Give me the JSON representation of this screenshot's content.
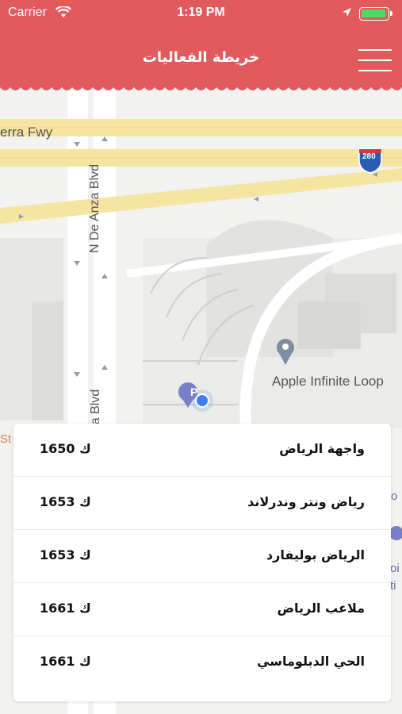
{
  "status_bar": {
    "carrier": "Carrier",
    "time": "1:19 PM",
    "battery_color": "#4cd964"
  },
  "header": {
    "title": "خريطة الفعاليات",
    "background": "#e05a5e",
    "menu_icon": "hamburger-icon"
  },
  "map": {
    "labels": {
      "freeway": "erra Fwy",
      "street_1": "N De Anza Blvd",
      "street_2": "a Blvd",
      "poi": "Apple Infinite Loop",
      "shield": "280",
      "edge_left_1": "St",
      "edge_right_1": "o",
      "edge_right_2": "oi",
      "edge_right_3": "ti"
    },
    "parking_icon_letter": "P"
  },
  "events": [
    {
      "name": "واجهة الرياض",
      "distance": "1650 ك"
    },
    {
      "name": "رياض ونتر وندرلاند",
      "distance": "1653 ك"
    },
    {
      "name": "الرياض بوليفارد",
      "distance": "1653 ك"
    },
    {
      "name": "ملاعب الرياض",
      "distance": "1661 ك"
    },
    {
      "name": "الحي الدبلوماسي",
      "distance": "1661 ك"
    }
  ]
}
